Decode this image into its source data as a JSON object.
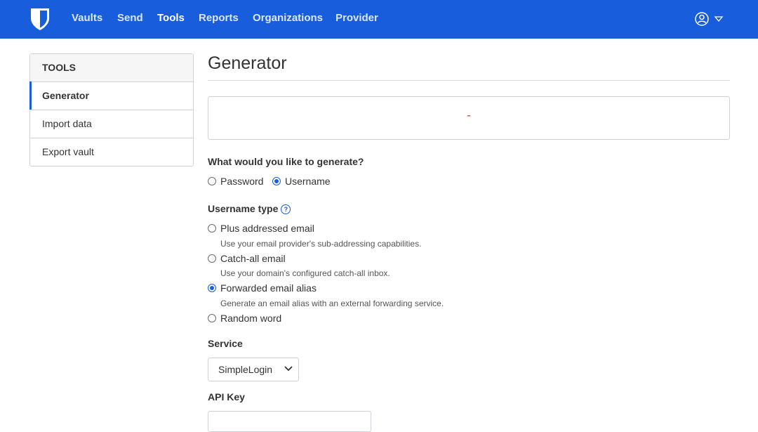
{
  "nav": {
    "items": [
      {
        "label": "Vaults",
        "active": false
      },
      {
        "label": "Send",
        "active": false
      },
      {
        "label": "Tools",
        "active": true
      },
      {
        "label": "Reports",
        "active": false
      },
      {
        "label": "Organizations",
        "active": false
      },
      {
        "label": "Provider",
        "active": false
      }
    ],
    "logo_icon": "bitwarden-shield-icon",
    "account_icon": "user-circle-icon"
  },
  "sidebar": {
    "header": "TOOLS",
    "items": [
      {
        "label": "Generator",
        "active": true
      },
      {
        "label": "Import data",
        "active": false
      },
      {
        "label": "Export vault",
        "active": false
      }
    ]
  },
  "main": {
    "title": "Generator",
    "generated_value": "-",
    "generate_question": "What would you like to generate?",
    "generate_options": [
      {
        "label": "Password",
        "selected": false
      },
      {
        "label": "Username",
        "selected": true
      }
    ],
    "username_type_label": "Username type",
    "username_types": [
      {
        "label": "Plus addressed email",
        "help": "Use your email provider's sub-addressing capabilities.",
        "selected": false
      },
      {
        "label": "Catch-all email",
        "help": "Use your domain's configured catch-all inbox.",
        "selected": false
      },
      {
        "label": "Forwarded email alias",
        "help": "Generate an email alias with an external forwarding service.",
        "selected": true
      },
      {
        "label": "Random word",
        "help": "",
        "selected": false
      }
    ],
    "service_label": "Service",
    "service_value": "SimpleLogin",
    "api_key_label": "API Key",
    "api_key_value": ""
  },
  "colors": {
    "brand": "#175ddc",
    "generated_text": "#c83522"
  }
}
